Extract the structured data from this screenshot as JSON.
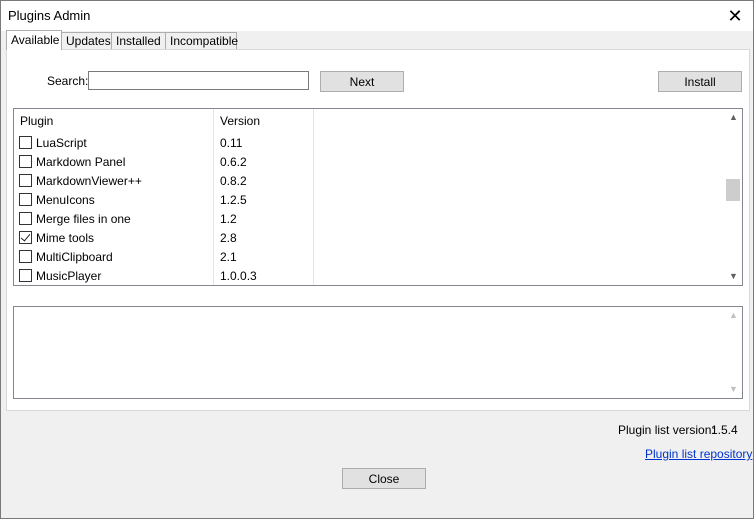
{
  "window": {
    "title": "Plugins Admin"
  },
  "tabs": [
    {
      "label": "Available",
      "active": true
    },
    {
      "label": "Updates",
      "active": false
    },
    {
      "label": "Installed",
      "active": false
    },
    {
      "label": "Incompatible",
      "active": false
    }
  ],
  "search": {
    "label": "Search:",
    "value": ""
  },
  "buttons": {
    "next": "Next",
    "install": "Install",
    "close": "Close"
  },
  "list": {
    "columns": [
      "Plugin",
      "Version"
    ],
    "rows": [
      {
        "name": "LuaScript",
        "version": "0.11",
        "checked": false
      },
      {
        "name": "Markdown Panel",
        "version": "0.6.2",
        "checked": false
      },
      {
        "name": "MarkdownViewer++",
        "version": "0.8.2",
        "checked": false
      },
      {
        "name": "MenuIcons",
        "version": "1.2.5",
        "checked": false
      },
      {
        "name": "Merge files in one",
        "version": "1.2",
        "checked": false
      },
      {
        "name": "Mime tools",
        "version": "2.8",
        "checked": true
      },
      {
        "name": "MultiClipboard",
        "version": "2.1",
        "checked": false
      },
      {
        "name": "MusicPlayer",
        "version": "1.0.0.3",
        "checked": false
      }
    ]
  },
  "footer": {
    "version_label": "Plugin list version:",
    "version_value": "1.5.4",
    "repo_link": "Plugin list repository"
  },
  "icons": {
    "close": "close-icon",
    "checkbox": "checkbox-icon",
    "scroll_up": "chevron-up-icon",
    "scroll_down": "chevron-down-icon"
  }
}
